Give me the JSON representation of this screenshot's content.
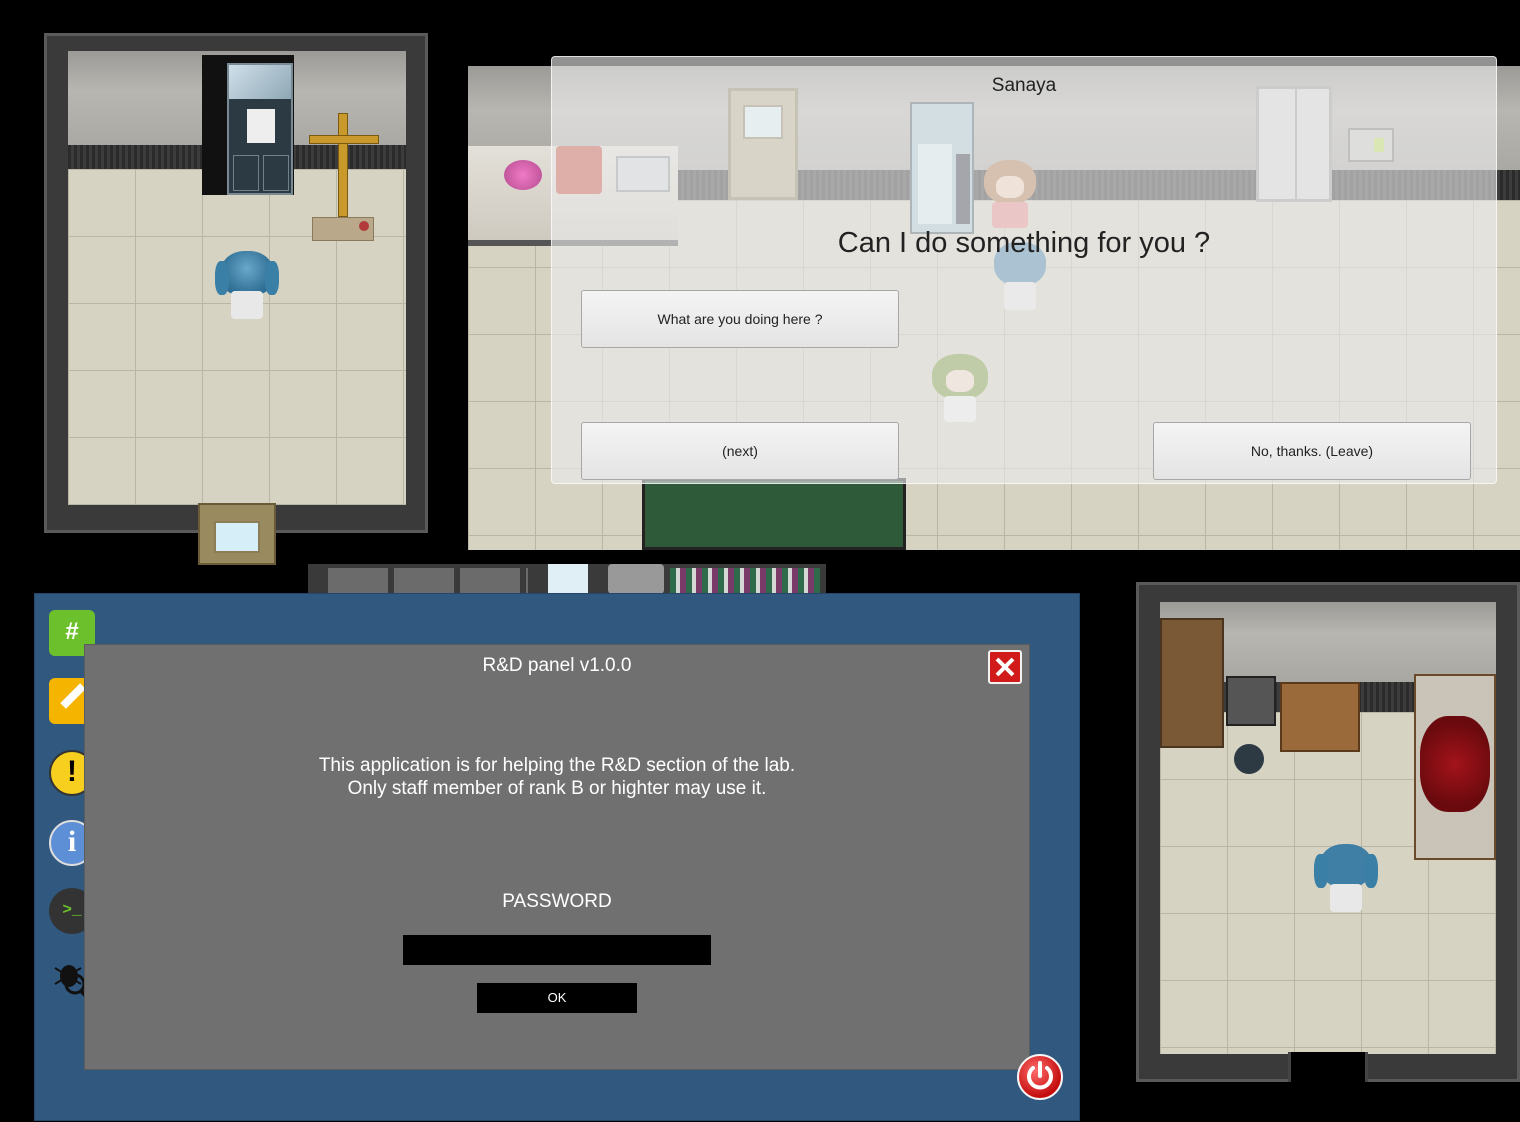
{
  "dialog": {
    "speaker": "Sanaya",
    "question": "Can I do something for you ?",
    "options": [
      {
        "label": "What are you doing here ?"
      },
      {
        "label": "(next)"
      },
      {
        "label": "No, thanks. (Leave)"
      }
    ]
  },
  "panel": {
    "title": "R&D panel v1.0.0",
    "description_line1": "This application is for helping the R&D section of the lab.",
    "description_line2": "Only staff member of rank B or highter may use it.",
    "password_label": "PASSWORD",
    "password_value": "",
    "ok_label": "OK"
  },
  "dock": {
    "icons": [
      "chat-hash-icon",
      "notes-pencil-icon",
      "warning-icon",
      "info-icon",
      "terminal-icon",
      "bug-search-icon"
    ],
    "chat_glyph": "#",
    "warning_glyph": "!",
    "info_glyph": "i",
    "terminal_glyph": ">_"
  },
  "colors": {
    "desktop_bg": "#31587f",
    "panel_bg": "#707070",
    "close_red": "#d11a1a",
    "dialog_overlay": "rgba(236,236,236,0.62)"
  }
}
